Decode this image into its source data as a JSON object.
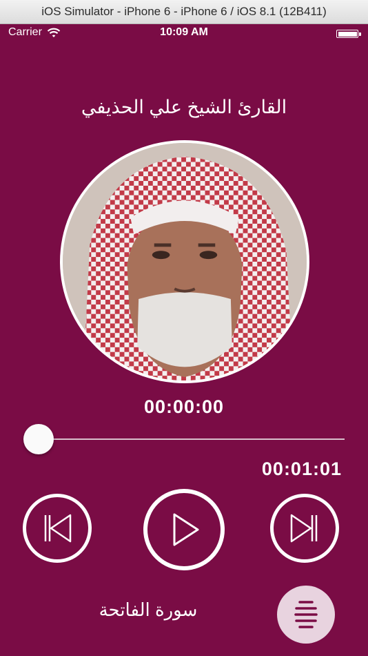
{
  "simulator": {
    "title": "iOS Simulator - iPhone 6 - iPhone 6 / iOS 8.1 (12B411)"
  },
  "statusbar": {
    "carrier": "Carrier",
    "time": "10:09 AM",
    "wifi_icon": "wifi-icon",
    "battery_icon": "battery-icon"
  },
  "player": {
    "reciter_name": "القارئ الشيخ علي الحذيفي",
    "current_time": "00:00:00",
    "total_time": "00:01:01",
    "progress_percent": 0,
    "surah_name": "سورة الفاتحة",
    "controls": {
      "previous_icon": "skip-previous-icon",
      "play_icon": "play-icon",
      "next_icon": "skip-next-icon",
      "menu_icon": "menu-icon"
    }
  },
  "colors": {
    "background": "#7a0c45",
    "accent": "#ffffff",
    "menu_button_bg": "#e8d3df",
    "menu_icon": "#7a0c45"
  }
}
